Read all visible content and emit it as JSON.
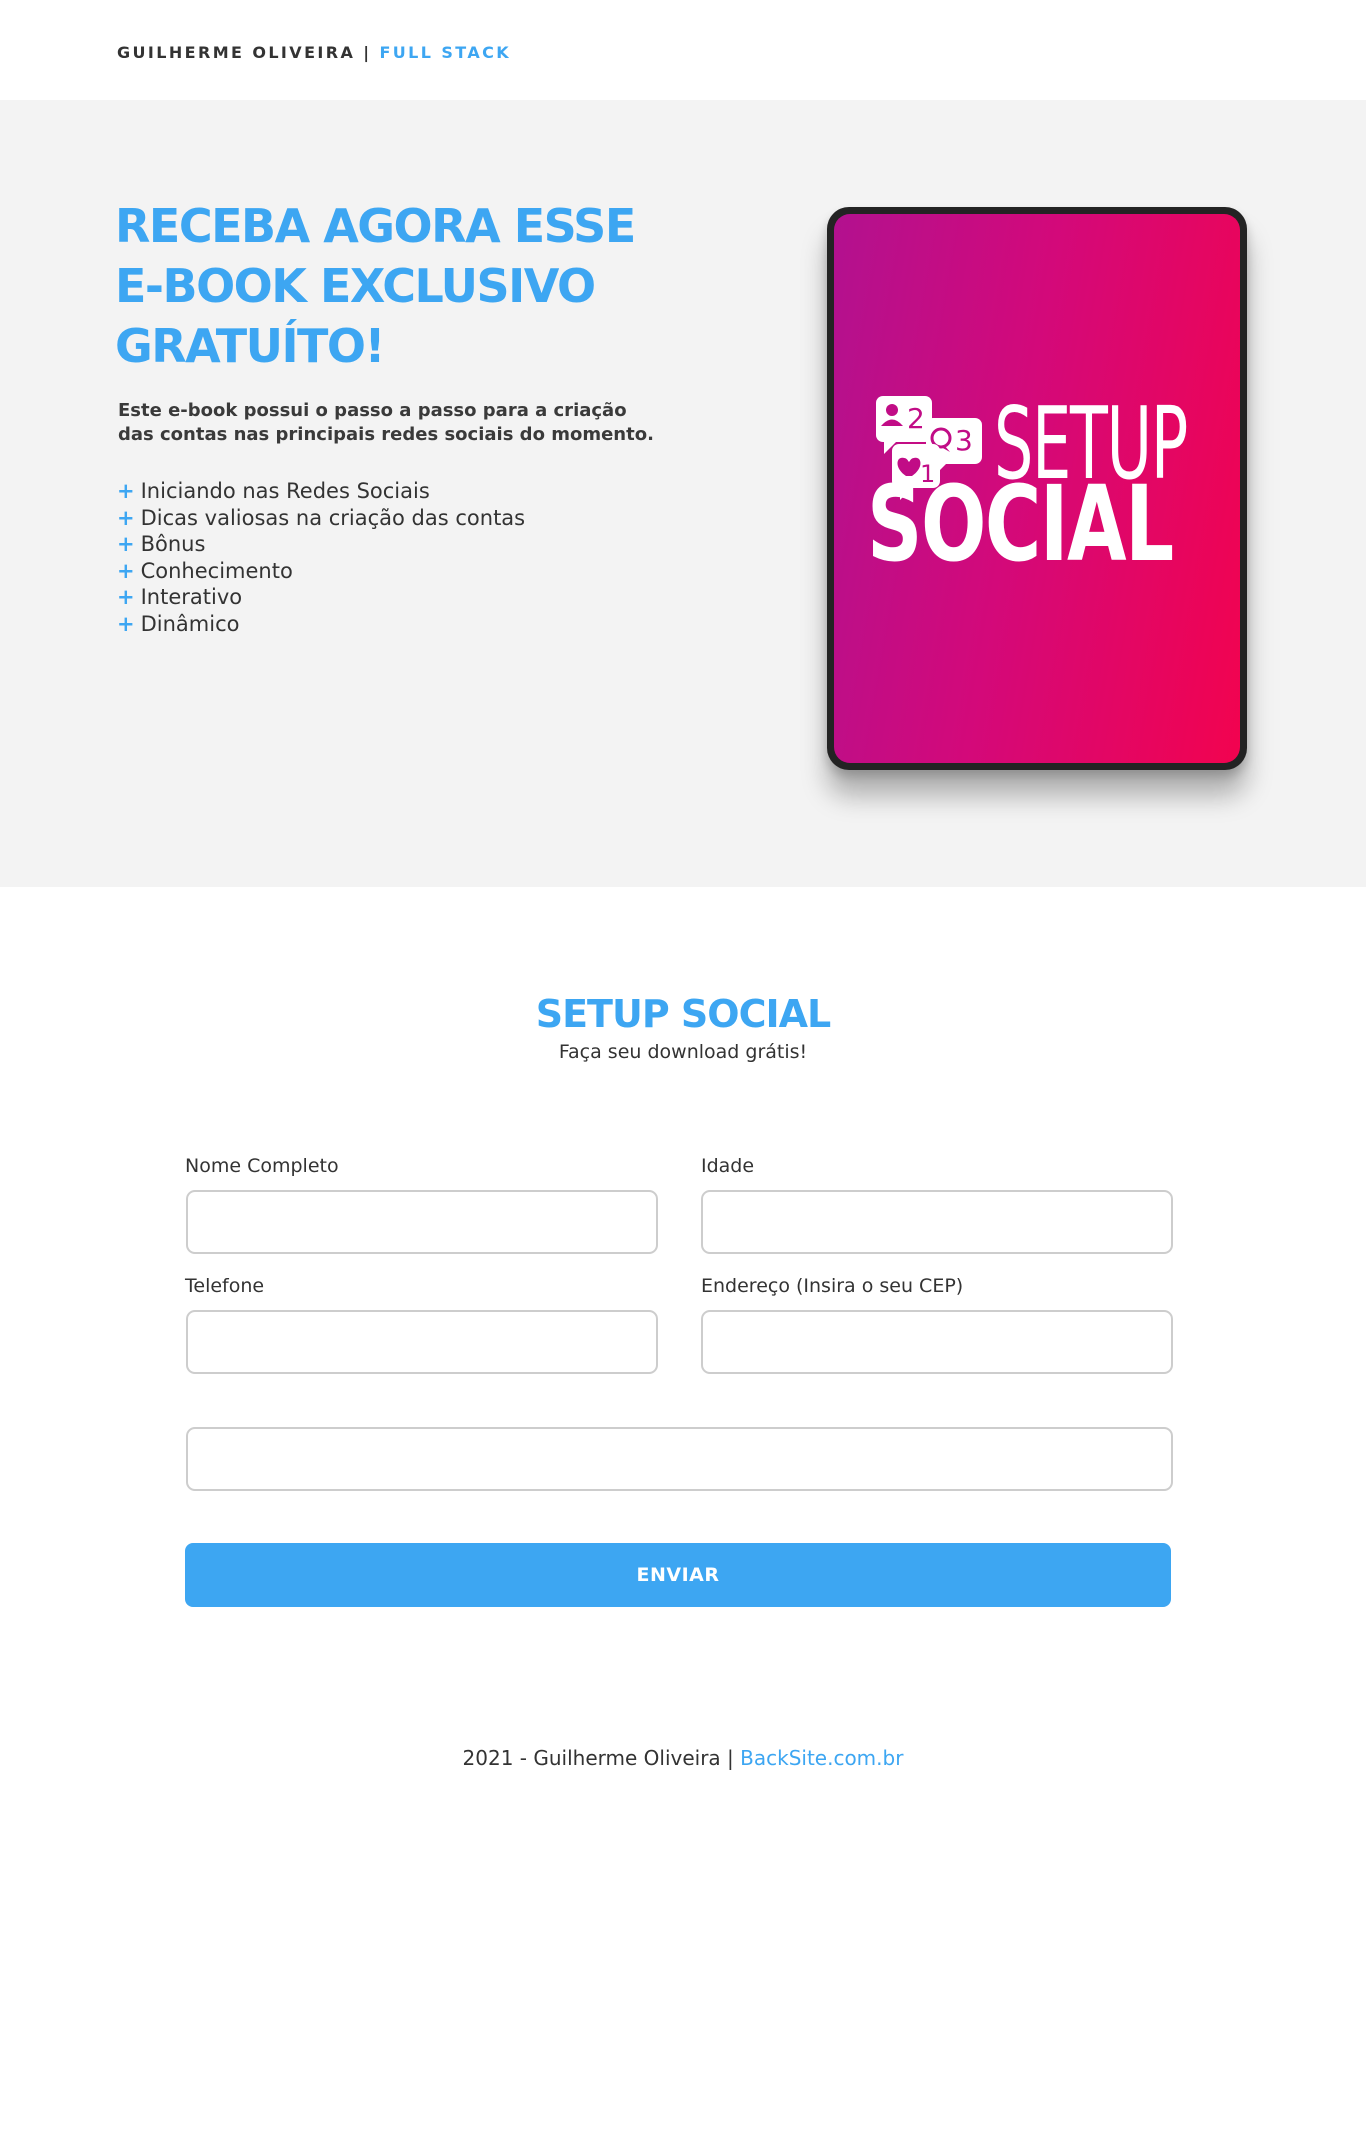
{
  "header": {
    "brand_name": "GUILHERME OLIVEIRA",
    "separator": " | ",
    "brand_role": "FULL STACK"
  },
  "hero": {
    "title_lines": [
      "RECEBA AGORA ESSE",
      "E-BOOK EXCLUSIVO",
      "GRATUÍTO!"
    ],
    "description_lines": [
      "Este e-book possui o passo a passo para a criação",
      "das contas nas principais redes sociais do momento."
    ],
    "feature_bullet": "+",
    "features": [
      "Iniciando nas Redes Sociais",
      "Dicas valiosas na criação das contas",
      "Bônus",
      "Conhecimento",
      "Interativo",
      "Dinâmico"
    ],
    "ebook_cover": {
      "word_top": "SETUP",
      "word_bottom": "SOCIAL",
      "badge_followers": "2",
      "badge_comments": "3",
      "badge_likes": "1"
    }
  },
  "form_section": {
    "title": "SETUP SOCIAL",
    "subtitle": "Faça seu download grátis!",
    "fields": {
      "full_name": {
        "label": "Nome Completo",
        "value": "",
        "placeholder": ""
      },
      "age": {
        "label": "Idade",
        "value": "",
        "placeholder": ""
      },
      "phone": {
        "label": "Telefone",
        "value": "",
        "placeholder": ""
      },
      "cep": {
        "label": "Endereço (Insira o seu CEP)",
        "value": "",
        "placeholder": ""
      },
      "address": {
        "value": "",
        "placeholder": ""
      }
    },
    "submit_label": "ENVIAR"
  },
  "footer": {
    "text": "2021 - Guilherme Oliveira | ",
    "link_text": "BackSite.com.br"
  },
  "colors": {
    "accent": "#3da6f2",
    "hero_background": "#f3f3f3",
    "cover_gradient_start": "#b2118f",
    "cover_gradient_end": "#f2034f"
  },
  "icons": [
    "user-notification-icon",
    "comment-notification-icon",
    "heart-notification-icon"
  ]
}
